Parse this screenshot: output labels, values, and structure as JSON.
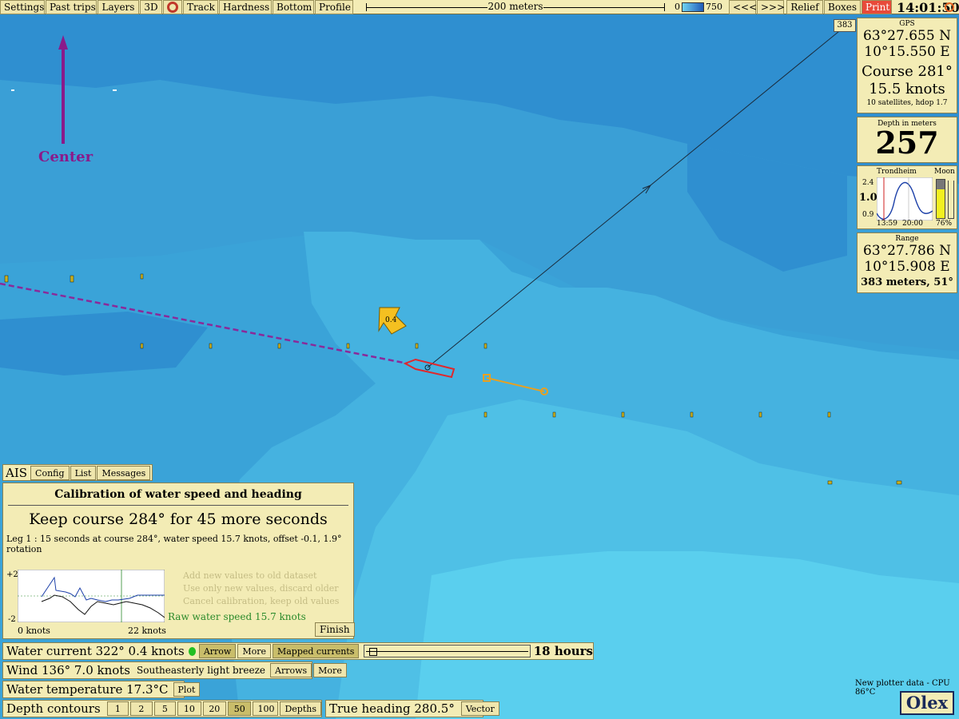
{
  "toolbar": {
    "buttons": [
      "Settings",
      "Past trips",
      "Layers",
      "3D",
      "Track",
      "Hardness",
      "Bottom",
      "Profile"
    ],
    "scale_label": "200 meters",
    "depth_min": "0",
    "depth_max": "750",
    "nav_back": "<<<",
    "nav_fwd": ">>>",
    "right_buttons": [
      "Relief",
      "Boxes",
      "Print"
    ],
    "time": "14:01:50"
  },
  "center_label": "Center",
  "range_tag": "383",
  "boat_speed_tag": "0.4",
  "gps": {
    "title": "GPS",
    "lat": "63°27.655 N",
    "lon": "10°15.550 E",
    "course": "Course 281°",
    "speed": "15.5 knots",
    "sats": "10 satellites, hdop 1.7"
  },
  "depth": {
    "title": "Depth in meters",
    "value": "257"
  },
  "tide": {
    "place": "Trondheim",
    "moon": "Moon",
    "y_max": "2.4",
    "y_mid": "1.0",
    "y_min": "0.9",
    "t1": "13:59",
    "t2": "20:00",
    "moon_pct": "76%",
    "moon_fill": 0.76
  },
  "range": {
    "title": "Range",
    "lat": "63°27.786 N",
    "lon": "10°15.908 E",
    "dist": "383 meters, 51°"
  },
  "ais": {
    "label": "AIS",
    "buttons": [
      "Config",
      "List",
      "Messages"
    ]
  },
  "calibration": {
    "title": "Calibration of water speed and heading",
    "instruction": "Keep course 284° for 45 more seconds",
    "leg": "Leg 1 : 15 seconds at course 284°, water speed 15.7 knots, offset -0.1, 1.9° rotation",
    "y_top": "+2",
    "y_bot": "-2",
    "x_left": "0 knots",
    "x_right": "22 knots",
    "options": [
      "Add new values to old dataset",
      "Use only new values, discard older",
      "Cancel calibration, keep old values"
    ],
    "raw_speed": "Raw water speed 15.7 knots",
    "finish": "Finish"
  },
  "current": {
    "label": "Water current 322° 0.4 knots",
    "buttons": [
      "Arrow",
      "More",
      "Mapped currents"
    ],
    "hours": "18 hours"
  },
  "wind": {
    "label": "Wind 136° 7.0 knots",
    "desc": "Southeasterly light breeze",
    "buttons": [
      "Arrows",
      "More"
    ]
  },
  "water_temp": {
    "label": "Water temperature 17.3°C",
    "button": "Plot"
  },
  "contours": {
    "label": "Depth contours",
    "values": [
      "1",
      "2",
      "5",
      "10",
      "20",
      "50",
      "100"
    ],
    "selected": "50",
    "depths_button": "Depths"
  },
  "heading": {
    "label": "True heading 280.5°",
    "button": "Vector"
  },
  "status": "New plotter data - CPU 86°C",
  "brand": "Olex",
  "colors": {
    "deep": "#2f8fd0",
    "mid": "#3aa5d8",
    "shallow": "#4fc2e4",
    "track": "#8a2a9a",
    "boat": "#e0282c",
    "panel": "#f3ecb5"
  }
}
